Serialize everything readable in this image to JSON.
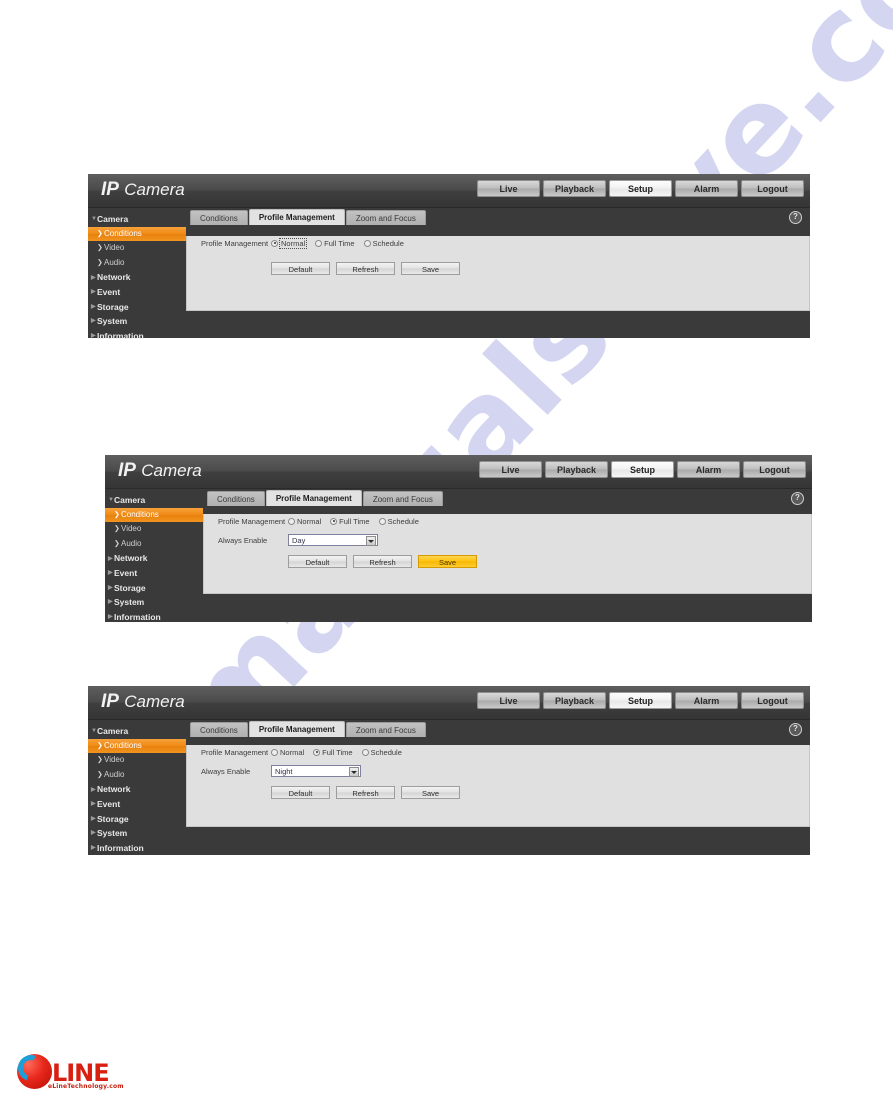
{
  "page": {
    "background": "#ffffff",
    "watermark_text": "manualshive.com",
    "watermark_color": "#9aa0e0"
  },
  "brand": {
    "bold": "IP",
    "regular": "Camera"
  },
  "colors": {
    "accent_orange": "#ef8a14",
    "highlight_yellow": "#ffc211",
    "panel_bg": "#e0e0e0",
    "device_bg": "#3a3a3a",
    "topbar_bg": "#4b4b4b"
  },
  "topnav": {
    "items": [
      {
        "label": "Live",
        "active": false
      },
      {
        "label": "Playback",
        "active": false
      },
      {
        "label": "Setup",
        "active": true
      },
      {
        "label": "Alarm",
        "active": false
      },
      {
        "label": "Logout",
        "active": false
      }
    ]
  },
  "sidebar": {
    "items": [
      {
        "label": "Camera",
        "type": "group",
        "expanded": true,
        "icon": "chevron-down-icon",
        "active": false
      },
      {
        "label": "Conditions",
        "type": "sub",
        "icon": "chevron-right-icon",
        "active": true
      },
      {
        "label": "Video",
        "type": "sub",
        "icon": "chevron-right-icon",
        "active": false
      },
      {
        "label": "Audio",
        "type": "sub",
        "icon": "chevron-right-icon",
        "active": false
      },
      {
        "label": "Network",
        "type": "group",
        "expanded": false,
        "icon": "chevron-right-icon",
        "active": false
      },
      {
        "label": "Event",
        "type": "group",
        "expanded": false,
        "icon": "chevron-right-icon",
        "active": false
      },
      {
        "label": "Storage",
        "type": "group",
        "expanded": false,
        "icon": "chevron-right-icon",
        "active": false
      },
      {
        "label": "System",
        "type": "group",
        "expanded": false,
        "icon": "chevron-right-icon",
        "active": false
      },
      {
        "label": "Information",
        "type": "group",
        "expanded": false,
        "icon": "chevron-right-icon",
        "active": false
      }
    ]
  },
  "tabs": [
    {
      "label": "Conditions",
      "active": false
    },
    {
      "label": "Profile Management",
      "active": true
    },
    {
      "label": "Zoom and Focus",
      "active": false
    }
  ],
  "help": {
    "icon": "help-icon",
    "glyph": "?"
  },
  "form": {
    "profile_management_label": "Profile Management",
    "always_enable_label": "Always Enable",
    "radio_options": [
      {
        "label": "Normal",
        "value": "normal"
      },
      {
        "label": "Full Time",
        "value": "fulltime"
      },
      {
        "label": "Schedule",
        "value": "schedule"
      }
    ],
    "dropdown_options": [
      "Day",
      "Night"
    ]
  },
  "buttons": {
    "default_label": "Default",
    "refresh_label": "Refresh",
    "save_label": "Save"
  },
  "figures": [
    {
      "id": "figure-1",
      "selected_radio": "normal",
      "radio_focused": "normal",
      "show_always_enable": false,
      "dropdown_value": "",
      "save_highlighted": false
    },
    {
      "id": "figure-2",
      "selected_radio": "fulltime",
      "radio_focused": "",
      "show_always_enable": true,
      "dropdown_value": "Day",
      "save_highlighted": true
    },
    {
      "id": "figure-3",
      "selected_radio": "fulltime",
      "radio_focused": "",
      "show_always_enable": true,
      "dropdown_value": "Night",
      "save_highlighted": false
    }
  ],
  "logo": {
    "word": "-LINE",
    "subtitle": "eLineTechnology.com"
  }
}
